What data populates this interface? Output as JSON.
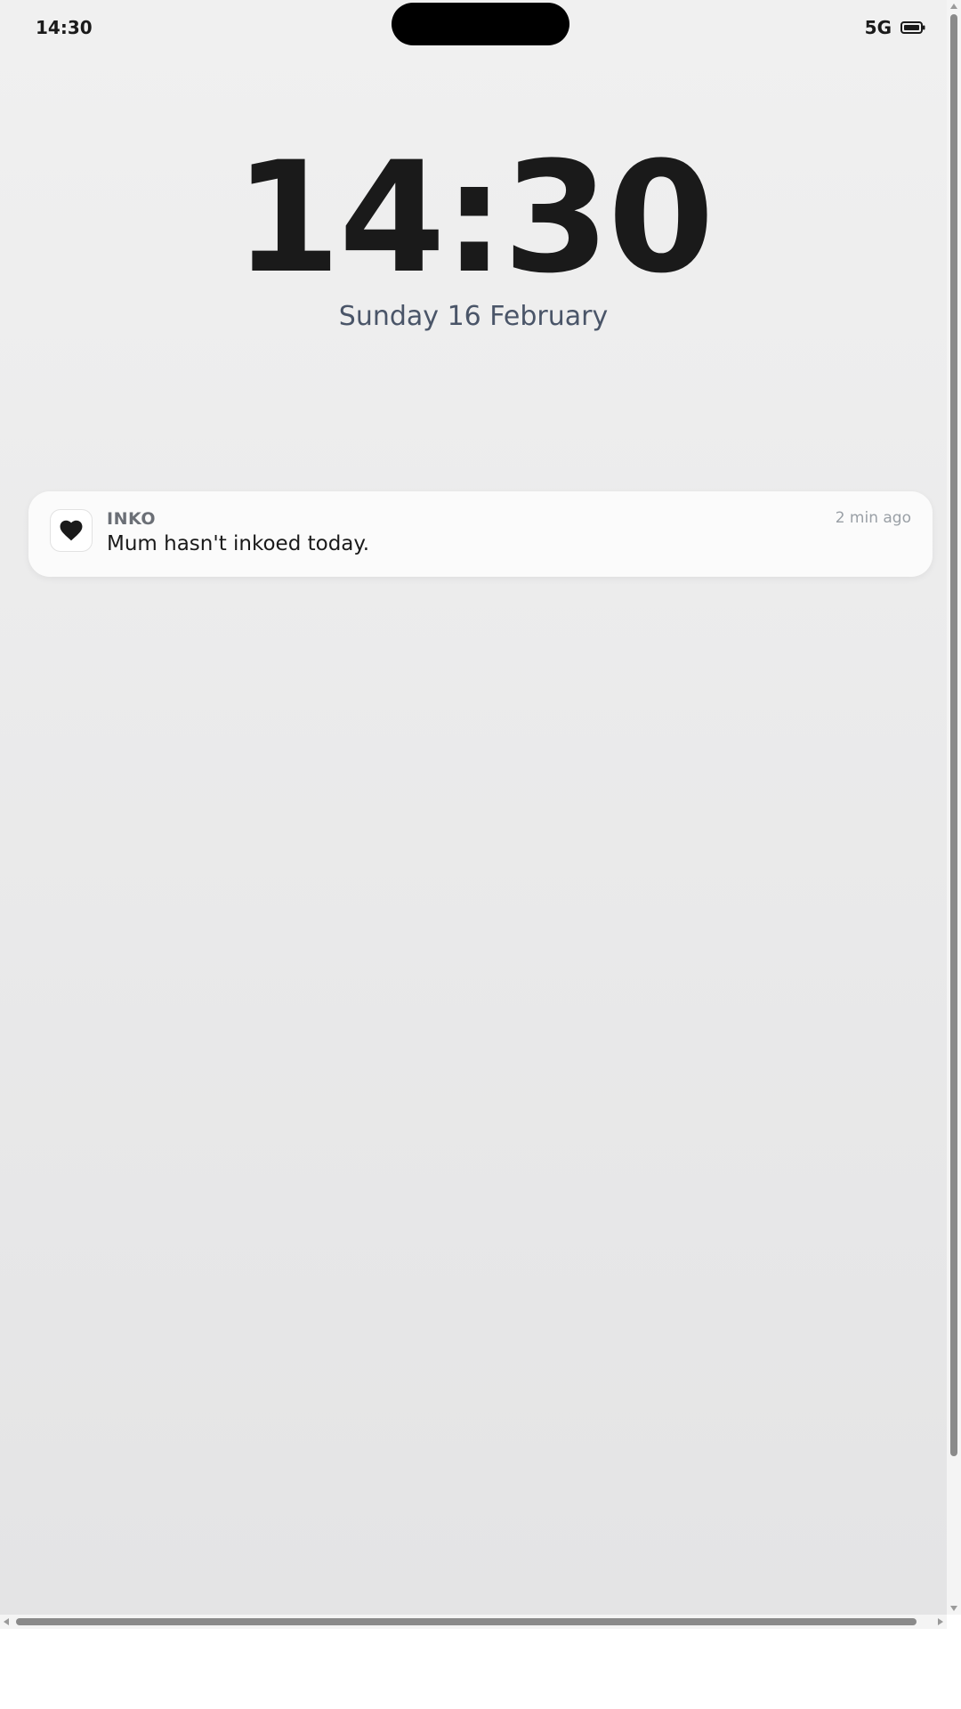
{
  "status_bar": {
    "time": "14:30",
    "network": "5G",
    "battery_icon": "battery-icon"
  },
  "lock_screen": {
    "time": "14:30",
    "date": "Sunday 16 February"
  },
  "notification": {
    "app_icon": "heart-icon",
    "app_name": "INKO",
    "time_ago": "2 min ago",
    "message": "Mum hasn't inkoed today."
  },
  "colors": {
    "background_top": "#f0f0f0",
    "background_bottom": "#e4e4e5",
    "text_primary": "#1a1a1a",
    "date_text": "#4a5568",
    "notification_bg": "#fcfcfc"
  }
}
